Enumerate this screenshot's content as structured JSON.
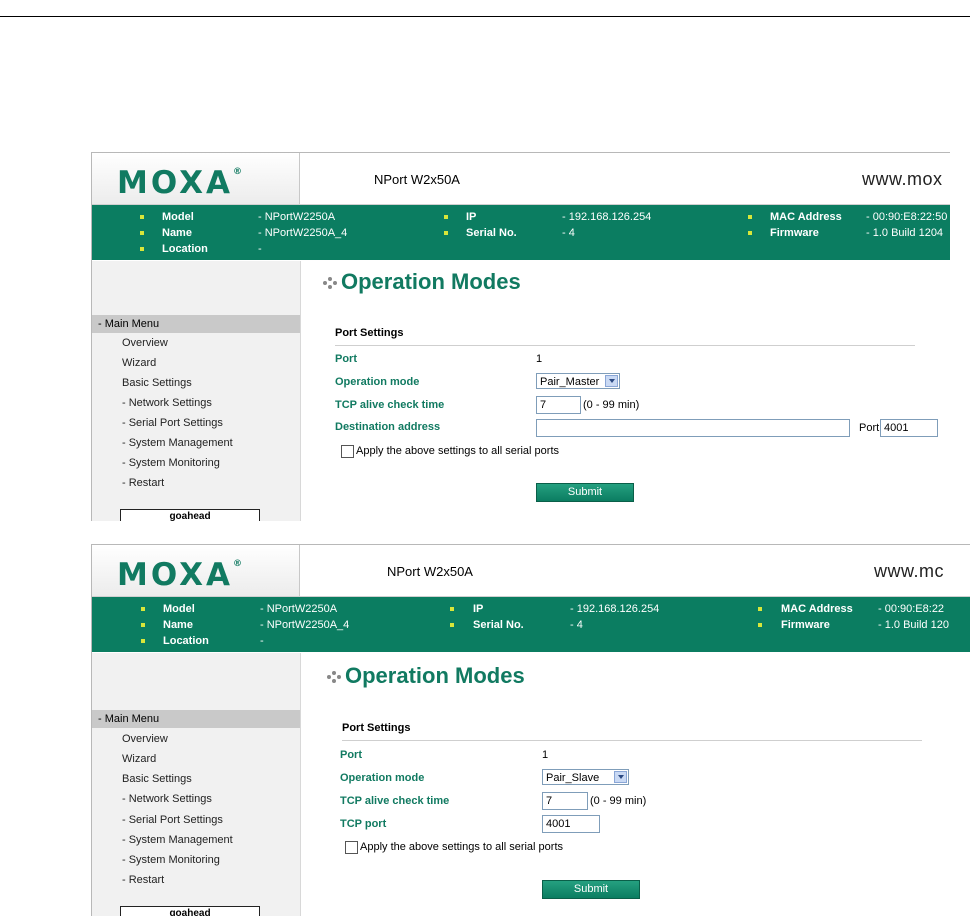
{
  "screens": [
    {
      "logo": "MOXA",
      "product": "NPort W2x50A",
      "www": "www.mox",
      "info": {
        "model_label": "Model",
        "model_value": "- NPortW2250A",
        "name_label": "Name",
        "name_value": "- NPortW2250A_4",
        "location_label": "Location",
        "location_value": "-",
        "ip_label": "IP",
        "ip_value": "- 192.168.126.254",
        "serial_label": "Serial No.",
        "serial_value": "- 4",
        "mac_label": "MAC Address",
        "mac_value": "- 00:90:E8:22:50",
        "firmware_label": "Firmware",
        "firmware_value": "- 1.0 Build 1204"
      },
      "menu": {
        "header": "- Main Menu",
        "items": [
          "Overview",
          "Wizard",
          "Basic Settings",
          "- Network Settings",
          "- Serial Port Settings",
          "- System Management",
          "- System Monitoring",
          "- Restart"
        ],
        "badge": "goahead"
      },
      "page_title": "Operation Modes",
      "section_title": "Port Settings",
      "fields": {
        "port_label": "Port",
        "port_value": "1",
        "mode_label": "Operation mode",
        "mode_value": "Pair_Master",
        "tcp_label": "TCP alive check time",
        "tcp_value": "7",
        "tcp_hint": "(0 - 99 min)",
        "dest_label": "Destination address",
        "dest_value": "",
        "dest_port_label": "Port",
        "dest_port_value": "4001"
      },
      "apply_label": "Apply the above settings to all serial ports",
      "submit_label": "Submit"
    },
    {
      "logo": "MOXA",
      "product": "NPort W2x50A",
      "www": "www.mc",
      "info": {
        "model_label": "Model",
        "model_value": "- NPortW2250A",
        "name_label": "Name",
        "name_value": "- NPortW2250A_4",
        "location_label": "Location",
        "location_value": "-",
        "ip_label": "IP",
        "ip_value": "- 192.168.126.254",
        "serial_label": "Serial No.",
        "serial_value": "- 4",
        "mac_label": "MAC Address",
        "mac_value": "- 00:90:E8:22",
        "firmware_label": "Firmware",
        "firmware_value": "- 1.0 Build 120"
      },
      "menu": {
        "header": "- Main Menu",
        "items": [
          "Overview",
          "Wizard",
          "Basic Settings",
          "- Network Settings",
          "- Serial Port Settings",
          "- System Management",
          "- System Monitoring",
          "- Restart"
        ],
        "badge": "goahead"
      },
      "page_title": "Operation Modes",
      "section_title": "Port Settings",
      "fields": {
        "port_label": "Port",
        "port_value": "1",
        "mode_label": "Operation mode",
        "mode_value": "Pair_Slave",
        "tcp_label": "TCP alive check time",
        "tcp_value": "7",
        "tcp_hint": "(0 - 99 min)",
        "tcpport_label": "TCP port",
        "tcpport_value": "4001"
      },
      "apply_label": "Apply the above settings to all serial ports",
      "submit_label": "Submit"
    }
  ],
  "colors": {
    "brand": "#117a61",
    "band": "#0b7d61",
    "bullet": "#d8e63a"
  },
  "icons": {
    "title_bullet": "title-dots-icon",
    "dropdown": "chevron-down-icon"
  }
}
